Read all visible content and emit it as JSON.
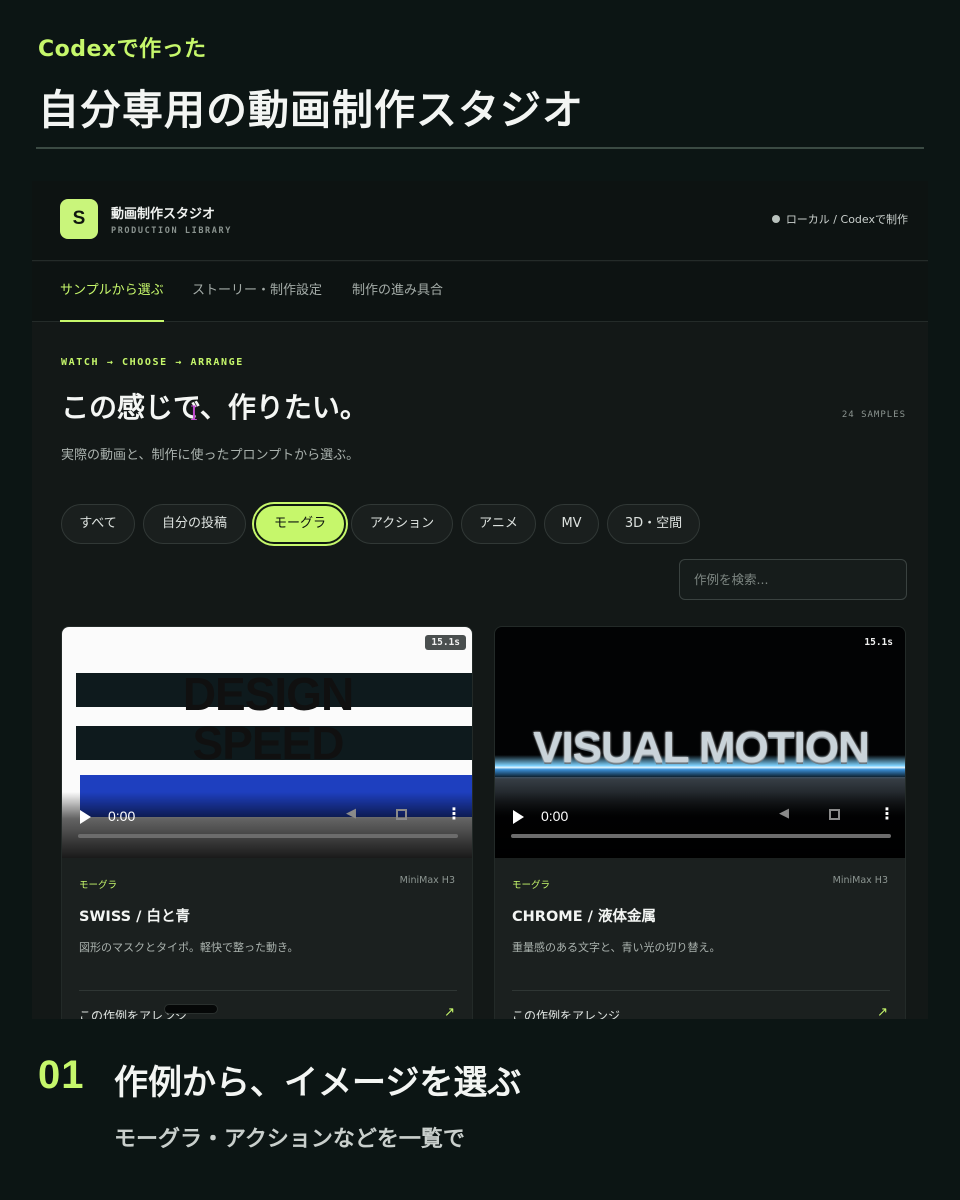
{
  "hero": {
    "kicker": "Codexで作った",
    "title": "自分専用の動画制作スタジオ"
  },
  "app": {
    "logo_letter": "S",
    "name": "動画制作スタジオ",
    "subtitle": "PRODUCTION LIBRARY",
    "status": "ローカル / Codexで制作"
  },
  "tabs": [
    {
      "label": "サンプルから選ぶ",
      "active": true
    },
    {
      "label": "ストーリー・制作設定",
      "active": false
    },
    {
      "label": "制作の進み具合",
      "active": false
    }
  ],
  "section": {
    "eyebrow": "WATCH → CHOOSE → ARRANGE",
    "title": "この感じで、作りたい。",
    "count": "24 SAMPLES",
    "description": "実際の動画と、制作に使ったプロンプトから選ぶ。"
  },
  "chips": [
    {
      "label": "すべて",
      "active": false
    },
    {
      "label": "自分の投稿",
      "active": false
    },
    {
      "label": "モーグラ",
      "active": true
    },
    {
      "label": "アクション",
      "active": false
    },
    {
      "label": "アニメ",
      "active": false
    },
    {
      "label": "MV",
      "active": false
    },
    {
      "label": "3D・空間",
      "active": false
    }
  ],
  "search": {
    "placeholder": "作例を検索..."
  },
  "cards": [
    {
      "duration": "15.1s",
      "media_lines": [
        "DESIGN",
        "SPEED"
      ],
      "time": "0:00",
      "tag": "モーグラ",
      "model": "MiniMax H3",
      "title": "SWISS / 白と青",
      "description": "図形のマスクとタイポ。軽快で整った動き。",
      "link": "この作例をアレンジ"
    },
    {
      "duration": "15.1s",
      "media_lines": [
        "VISUAL MOTION"
      ],
      "time": "0:00",
      "tag": "モーグラ",
      "model": "MiniMax H3",
      "title": "CHROME / 液体金属",
      "description": "重量感のある文字と、青い光の切り替え。",
      "link": "この作例をアレンジ"
    }
  ],
  "step": {
    "number": "01",
    "title": "作例から、イメージを選ぶ",
    "subtitle": "モーグラ・アクションなどを一覧で"
  },
  "colors": {
    "accent": "#c6f76b",
    "background": "#0c1514",
    "panel": "#131817"
  }
}
